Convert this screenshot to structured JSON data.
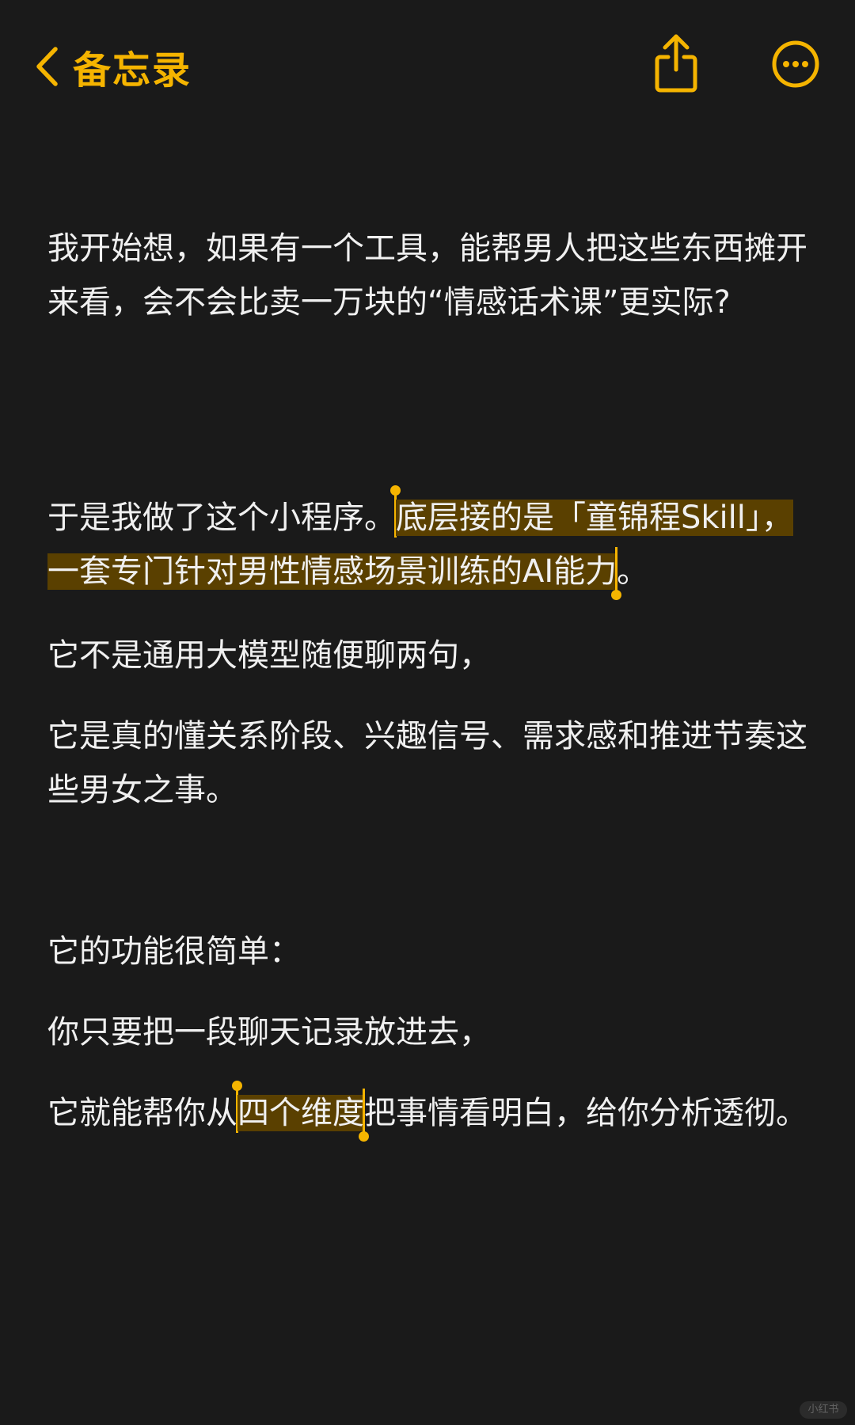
{
  "nav": {
    "back_label": "备忘录",
    "accent_color": "#f5b400",
    "icons": [
      "chevron-left-icon",
      "share-icon",
      "more-icon"
    ]
  },
  "note": {
    "p1": "我开始想，如果有一个工具，能帮男人把这些东西摊开来看，会不会比卖一万块的“情感话术课”更实际?",
    "p2_before": "于是我做了这个小程序。",
    "p2_selected": "底层接的是「童锦程Skill」，一套专门针对男性情感场景训练的AI能力",
    "p2_after": "。",
    "p3": "它不是通用大模型随便聊两句，",
    "p4": "它是真的懂关系阶段、兴趣信号、需求感和推进节奏这些男女之事。",
    "p5": "它的功能很简单：",
    "p6": "你只要把一段聊天记录放进去，",
    "p7_before": "它就能帮你从",
    "p7_selected": "四个维度",
    "p7_after": "把事情看明白，给你分析透彻。",
    "selection_color": "#5a4000"
  },
  "watermark": "小红书"
}
